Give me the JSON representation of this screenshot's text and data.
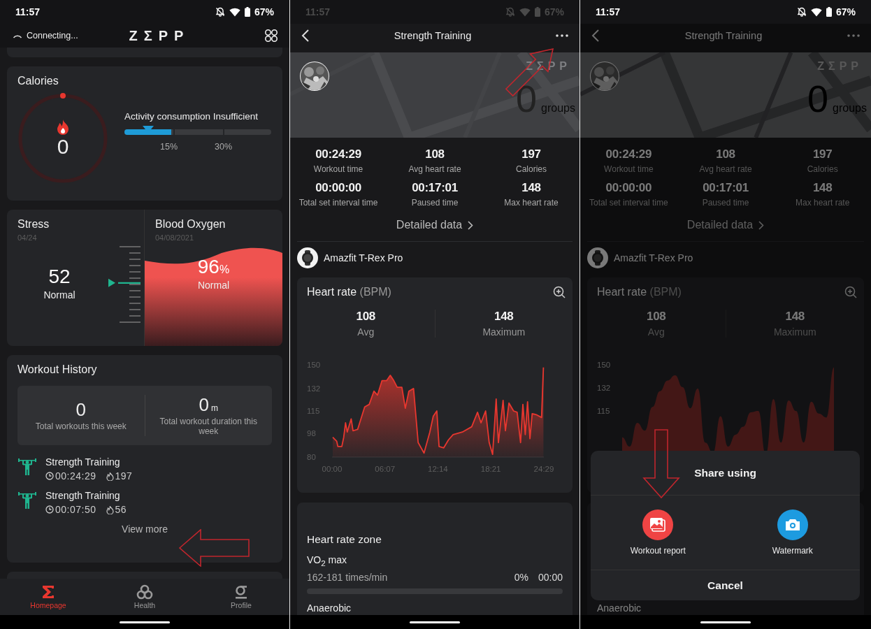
{
  "screens": [
    {
      "kind": "home",
      "status_bar": {
        "time": "11:57",
        "battery": "67%",
        "dimmed": false
      },
      "header": {
        "status": "Connecting...",
        "logo": "ZΣPP"
      },
      "calories": {
        "title": "Calories",
        "value": "0",
        "activity_label": "Activity consumption Insufficient",
        "bar": {
          "level": 0.32
        },
        "marker": {
          "level": 0.16
        },
        "ticks": [
          "15%",
          "30%"
        ]
      },
      "stress": {
        "title": "Stress",
        "date": "04/24",
        "value": "52",
        "status": "Normal",
        "pointer": {
          "level": 0.52
        }
      },
      "blood_oxygen": {
        "title": "Blood Oxygen",
        "date": "04/08/2021",
        "value": "96",
        "unit": "%",
        "status": "Normal"
      },
      "workout_history": {
        "title": "Workout History",
        "totals": [
          {
            "value": "0",
            "label": "Total workouts this week"
          },
          {
            "value": "0",
            "unit": "m",
            "label": "Total workout duration this week"
          }
        ],
        "entries": [
          {
            "name": "Strength Training",
            "duration": "00:24:29",
            "calories": "197"
          },
          {
            "name": "Strength Training",
            "duration": "00:07:50",
            "calories": "56"
          }
        ],
        "view_more": "View more"
      },
      "nav": [
        {
          "label": "Homepage",
          "selected": true
        },
        {
          "label": "Health",
          "selected": false
        },
        {
          "label": "Profile",
          "selected": false
        }
      ]
    },
    {
      "kind": "workout_detail",
      "dimmed": false,
      "status_bar": {
        "time": "11:57",
        "battery": "67%",
        "dimmed": true
      },
      "header": {
        "title": "Strength Training"
      },
      "banner": {
        "logo": "ZΣPP",
        "count": "0",
        "unit": "groups"
      },
      "stats": [
        {
          "value": "00:24:29",
          "label": "Workout time"
        },
        {
          "value": "108",
          "label": "Avg heart rate"
        },
        {
          "value": "197",
          "label": "Calories"
        },
        {
          "value": "00:00:00",
          "label": "Total set interval time"
        },
        {
          "value": "00:17:01",
          "label": "Paused time"
        },
        {
          "value": "148",
          "label": "Max heart rate"
        }
      ],
      "detailed_link": "Detailed data",
      "device": "Amazfit T-Rex Pro",
      "heart_rate": {
        "title": "Heart rate",
        "unit": "(BPM)",
        "summary": [
          {
            "value": "108",
            "label": "Avg"
          },
          {
            "value": "148",
            "label": "Maximum"
          }
        ],
        "chart_data": {
          "type": "area",
          "xlim": [
            0,
            24.48
          ],
          "ylim": [
            80,
            150
          ],
          "yticks": [
            80,
            98,
            115,
            132,
            150
          ],
          "xticks": [
            {
              "value": 0,
              "label": "00:00"
            },
            {
              "value": 6.12,
              "label": "06:07"
            },
            {
              "value": 12.23,
              "label": "12:14"
            },
            {
              "value": 18.35,
              "label": "18:21"
            },
            {
              "value": 24.48,
              "label": "24:29"
            }
          ],
          "x": [
            0.08,
            0.54,
            0.67,
            1.13,
            1.35,
            1.56,
            1.75,
            2.21,
            2.42,
            2.96,
            3.77,
            4.3,
            4.84,
            5.25,
            5.78,
            6.32,
            6.73,
            7.13,
            7.53,
            8.07,
            8.47,
            8.88,
            9.42,
            9.95,
            10.63,
            11.3,
            11.7,
            12.11,
            12.37,
            12.91,
            13.45,
            13.99,
            15.06,
            16.14,
            16.81,
            17.22,
            17.75,
            18.16,
            18.56,
            18.97,
            19.23,
            19.77,
            20.04,
            20.45,
            20.98,
            21.39,
            21.79,
            22.06,
            22.33,
            22.6,
            22.87,
            23.13,
            23.67,
            24.21,
            24.43
          ],
          "series": [
            {
              "color": "#e8372f",
              "values": [
                95,
                92,
                88,
                88,
                95,
                106,
                99,
                109,
                100,
                101,
                118,
                120,
                130,
                127,
                138,
                138,
                142,
                138,
                133,
                133,
                117,
                130,
                132,
                91,
                83,
                99,
                111,
                115,
                88,
                87,
                93,
                97,
                99,
                103,
                114,
                106,
                115,
                91,
                82,
                124,
                91,
                123,
                100,
                121,
                115,
                114,
                91,
                120,
                97,
                122,
                94,
                113,
                112,
                110,
                148
              ]
            }
          ]
        }
      },
      "zones": {
        "title": "Heart rate zone",
        "items": [
          {
            "name": "VO$_{2}$ max",
            "range": "162-181 times/min",
            "percent": "0%",
            "time": "00:00",
            "level": 0
          },
          {
            "name": "Anaerobic"
          }
        ]
      }
    },
    {
      "kind": "workout_detail",
      "dimmed": true,
      "status_bar": {
        "time": "11:57",
        "battery": "67%",
        "dimmed": false
      },
      "header": {
        "title": "Strength Training"
      },
      "banner": {
        "logo": "ZΣPP",
        "count": "0",
        "unit": "groups"
      },
      "stats": [
        {
          "value": "00:24:29",
          "label": "Workout time"
        },
        {
          "value": "108",
          "label": "Avg heart rate"
        },
        {
          "value": "197",
          "label": "Calories"
        },
        {
          "value": "00:00:00",
          "label": "Total set interval time"
        },
        {
          "value": "00:17:01",
          "label": "Paused time"
        },
        {
          "value": "148",
          "label": "Max heart rate"
        }
      ],
      "detailed_link": "Detailed data",
      "device": "Amazfit T-Rex Pro",
      "heart_rate": {
        "title": "Heart rate",
        "unit": "(BPM)",
        "summary": [
          {
            "value": "108",
            "label": "Avg"
          },
          {
            "value": "148",
            "label": "Maximum"
          }
        ],
        "y_labels": [
          "150",
          "132",
          "115"
        ]
      },
      "zones": {
        "items": [
          {
            "name": "Anaerobic"
          }
        ]
      },
      "share_sheet": {
        "title": "Share using",
        "options": [
          {
            "label": "Workout report",
            "color": "#ef4444"
          },
          {
            "label": "Watermark",
            "color": "#1d9be0"
          }
        ],
        "cancel": "Cancel"
      }
    }
  ]
}
